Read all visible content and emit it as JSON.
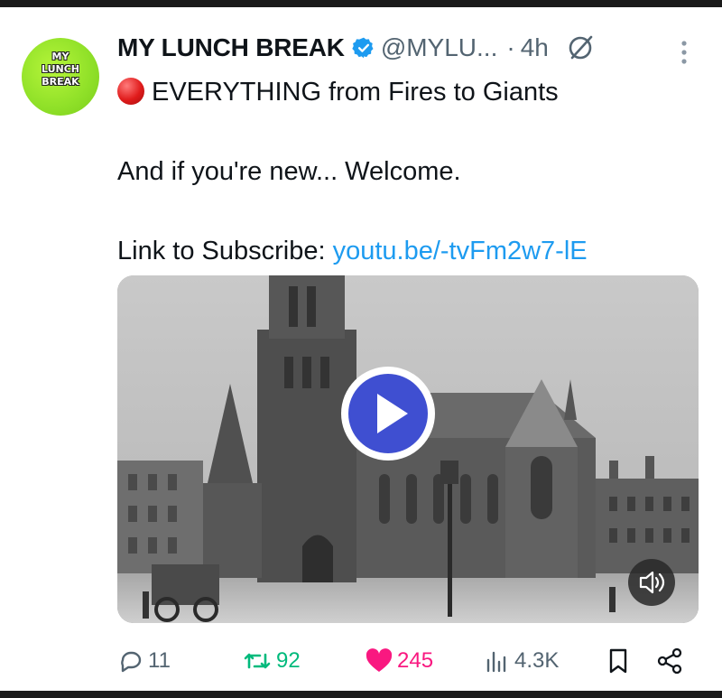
{
  "tweet": {
    "author_name": "MY LUNCH BREAK",
    "handle": "@MYLU...",
    "separator": "·",
    "time": "4h",
    "avatar_text": [
      "MY",
      "LUNCH",
      "BREAK"
    ],
    "lines": {
      "line1": "EVERYTHING from Fires to Giants",
      "line2": "And if you're new... Welcome.",
      "line3_prefix": "Link to Subscribe: ",
      "line3_link": "youtu.be/-tvFm2w7-lE"
    }
  },
  "actions": {
    "replies": "11",
    "reposts": "92",
    "likes": "245",
    "views": "4.3K"
  },
  "icons": [
    "verified-badge-icon",
    "hidden-eye-icon",
    "more-vertical-icon",
    "red-circle-emoji-icon",
    "play-icon",
    "volume-icon",
    "reply-icon",
    "repost-icon",
    "like-icon",
    "views-icon",
    "bookmark-icon",
    "share-icon"
  ],
  "colors": {
    "text": "#0f1419",
    "muted": "#536471",
    "link": "#1d9bf0",
    "repost": "#00ba7c",
    "like": "#f91880",
    "play": "#3f4fd1",
    "avatar": "#8fe028"
  }
}
